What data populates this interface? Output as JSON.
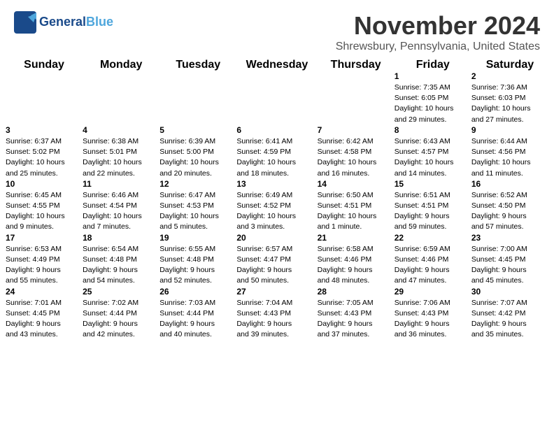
{
  "logo": {
    "text1": "General",
    "text2": "Blue"
  },
  "title": "November 2024",
  "location": "Shrewsbury, Pennsylvania, United States",
  "days_header": [
    "Sunday",
    "Monday",
    "Tuesday",
    "Wednesday",
    "Thursday",
    "Friday",
    "Saturday"
  ],
  "weeks": [
    [
      {
        "day": "",
        "info": ""
      },
      {
        "day": "",
        "info": ""
      },
      {
        "day": "",
        "info": ""
      },
      {
        "day": "",
        "info": ""
      },
      {
        "day": "",
        "info": ""
      },
      {
        "day": "1",
        "info": "Sunrise: 7:35 AM\nSunset: 6:05 PM\nDaylight: 10 hours\nand 29 minutes."
      },
      {
        "day": "2",
        "info": "Sunrise: 7:36 AM\nSunset: 6:03 PM\nDaylight: 10 hours\nand 27 minutes."
      }
    ],
    [
      {
        "day": "3",
        "info": "Sunrise: 6:37 AM\nSunset: 5:02 PM\nDaylight: 10 hours\nand 25 minutes."
      },
      {
        "day": "4",
        "info": "Sunrise: 6:38 AM\nSunset: 5:01 PM\nDaylight: 10 hours\nand 22 minutes."
      },
      {
        "day": "5",
        "info": "Sunrise: 6:39 AM\nSunset: 5:00 PM\nDaylight: 10 hours\nand 20 minutes."
      },
      {
        "day": "6",
        "info": "Sunrise: 6:41 AM\nSunset: 4:59 PM\nDaylight: 10 hours\nand 18 minutes."
      },
      {
        "day": "7",
        "info": "Sunrise: 6:42 AM\nSunset: 4:58 PM\nDaylight: 10 hours\nand 16 minutes."
      },
      {
        "day": "8",
        "info": "Sunrise: 6:43 AM\nSunset: 4:57 PM\nDaylight: 10 hours\nand 14 minutes."
      },
      {
        "day": "9",
        "info": "Sunrise: 6:44 AM\nSunset: 4:56 PM\nDaylight: 10 hours\nand 11 minutes."
      }
    ],
    [
      {
        "day": "10",
        "info": "Sunrise: 6:45 AM\nSunset: 4:55 PM\nDaylight: 10 hours\nand 9 minutes."
      },
      {
        "day": "11",
        "info": "Sunrise: 6:46 AM\nSunset: 4:54 PM\nDaylight: 10 hours\nand 7 minutes."
      },
      {
        "day": "12",
        "info": "Sunrise: 6:47 AM\nSunset: 4:53 PM\nDaylight: 10 hours\nand 5 minutes."
      },
      {
        "day": "13",
        "info": "Sunrise: 6:49 AM\nSunset: 4:52 PM\nDaylight: 10 hours\nand 3 minutes."
      },
      {
        "day": "14",
        "info": "Sunrise: 6:50 AM\nSunset: 4:51 PM\nDaylight: 10 hours\nand 1 minute."
      },
      {
        "day": "15",
        "info": "Sunrise: 6:51 AM\nSunset: 4:51 PM\nDaylight: 9 hours\nand 59 minutes."
      },
      {
        "day": "16",
        "info": "Sunrise: 6:52 AM\nSunset: 4:50 PM\nDaylight: 9 hours\nand 57 minutes."
      }
    ],
    [
      {
        "day": "17",
        "info": "Sunrise: 6:53 AM\nSunset: 4:49 PM\nDaylight: 9 hours\nand 55 minutes."
      },
      {
        "day": "18",
        "info": "Sunrise: 6:54 AM\nSunset: 4:48 PM\nDaylight: 9 hours\nand 54 minutes."
      },
      {
        "day": "19",
        "info": "Sunrise: 6:55 AM\nSunset: 4:48 PM\nDaylight: 9 hours\nand 52 minutes."
      },
      {
        "day": "20",
        "info": "Sunrise: 6:57 AM\nSunset: 4:47 PM\nDaylight: 9 hours\nand 50 minutes."
      },
      {
        "day": "21",
        "info": "Sunrise: 6:58 AM\nSunset: 4:46 PM\nDaylight: 9 hours\nand 48 minutes."
      },
      {
        "day": "22",
        "info": "Sunrise: 6:59 AM\nSunset: 4:46 PM\nDaylight: 9 hours\nand 47 minutes."
      },
      {
        "day": "23",
        "info": "Sunrise: 7:00 AM\nSunset: 4:45 PM\nDaylight: 9 hours\nand 45 minutes."
      }
    ],
    [
      {
        "day": "24",
        "info": "Sunrise: 7:01 AM\nSunset: 4:45 PM\nDaylight: 9 hours\nand 43 minutes."
      },
      {
        "day": "25",
        "info": "Sunrise: 7:02 AM\nSunset: 4:44 PM\nDaylight: 9 hours\nand 42 minutes."
      },
      {
        "day": "26",
        "info": "Sunrise: 7:03 AM\nSunset: 4:44 PM\nDaylight: 9 hours\nand 40 minutes."
      },
      {
        "day": "27",
        "info": "Sunrise: 7:04 AM\nSunset: 4:43 PM\nDaylight: 9 hours\nand 39 minutes."
      },
      {
        "day": "28",
        "info": "Sunrise: 7:05 AM\nSunset: 4:43 PM\nDaylight: 9 hours\nand 37 minutes."
      },
      {
        "day": "29",
        "info": "Sunrise: 7:06 AM\nSunset: 4:43 PM\nDaylight: 9 hours\nand 36 minutes."
      },
      {
        "day": "30",
        "info": "Sunrise: 7:07 AM\nSunset: 4:42 PM\nDaylight: 9 hours\nand 35 minutes."
      }
    ]
  ]
}
